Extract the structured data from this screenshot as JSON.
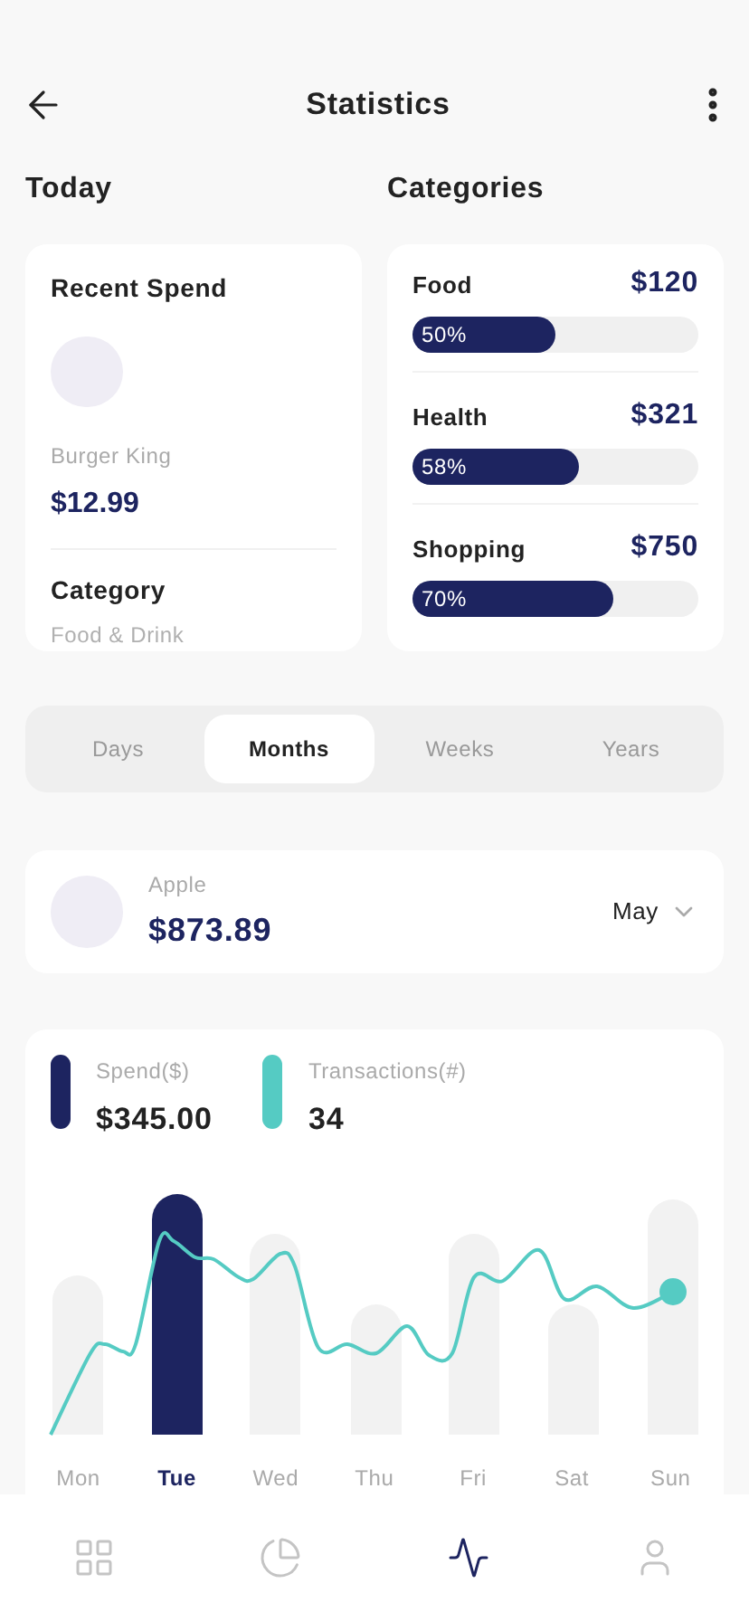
{
  "header": {
    "title": "Statistics"
  },
  "today": {
    "heading": "Today",
    "card_title": "Recent Spend",
    "merchant": "Burger King",
    "amount": "$12.99",
    "category_label": "Category",
    "category": "Food & Drink"
  },
  "categories": {
    "heading": "Categories",
    "items": [
      {
        "name": "Food",
        "amount": "$120",
        "percent": "50%",
        "level": 0.5
      },
      {
        "name": "Health",
        "amount": "$321",
        "percent": "58%",
        "level": 0.58
      },
      {
        "name": "Shopping",
        "amount": "$750",
        "percent": "70%",
        "level": 0.7
      }
    ]
  },
  "period_tabs": [
    {
      "label": "Days",
      "selected": false
    },
    {
      "label": "Months",
      "selected": true
    },
    {
      "label": "Weeks",
      "selected": false
    },
    {
      "label": "Years",
      "selected": false
    }
  ],
  "account": {
    "name": "Apple",
    "amount": "$873.89",
    "month": "May"
  },
  "stats": {
    "legend": [
      {
        "label": "Spend($)",
        "value": "$345.00",
        "color": "#1d2460"
      },
      {
        "label": "Transactions(#)",
        "value": "34",
        "color": "#55cbc3"
      }
    ],
    "days": [
      {
        "label": "Mon",
        "selected": false
      },
      {
        "label": "Tue",
        "selected": true
      },
      {
        "label": "Wed",
        "selected": false
      },
      {
        "label": "Thu",
        "selected": false
      },
      {
        "label": "Fri",
        "selected": false
      },
      {
        "label": "Sat",
        "selected": false
      },
      {
        "label": "Sun",
        "selected": false
      }
    ]
  },
  "nav": [
    {
      "kind": "grid",
      "selected": false
    },
    {
      "kind": "pie",
      "selected": false
    },
    {
      "kind": "pulse",
      "selected": true
    },
    {
      "kind": "user",
      "selected": false
    }
  ]
}
